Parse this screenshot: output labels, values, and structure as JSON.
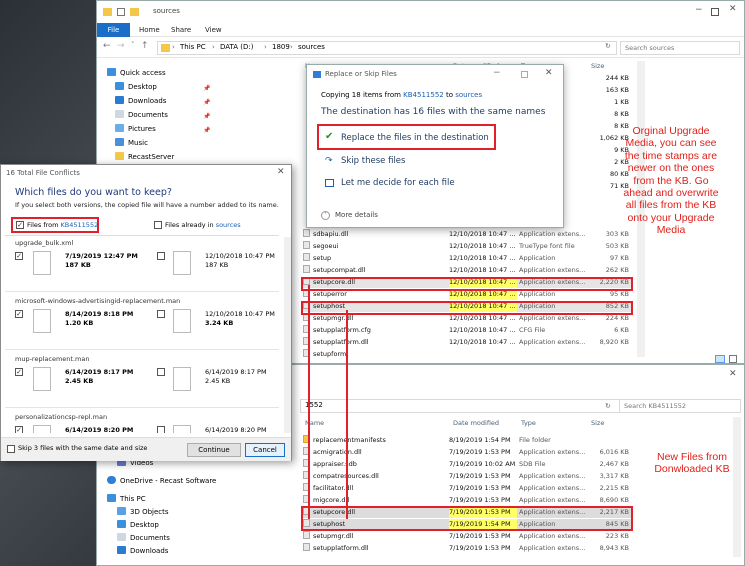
{
  "top_window": {
    "title": "sources",
    "ribbon_tabs": [
      "File",
      "Home",
      "Share",
      "View"
    ],
    "breadcrumb": [
      "This PC",
      "DATA (D:)",
      "1809",
      "sources"
    ],
    "search_placeholder": "Search sources",
    "columns": {
      "name": "Name",
      "date": "Date modified",
      "type": "Type",
      "size": "Size"
    },
    "nav": [
      "Quick access",
      "Desktop",
      "Downloads",
      "Documents",
      "Pictures",
      "Music",
      "RecastServer"
    ],
    "sizes_top": [
      "244 KB",
      "163 KB",
      "1 KB",
      "8 KB",
      "8 KB",
      "1,062 KB",
      "9 KB",
      "2 KB",
      "80 KB",
      "71 KB"
    ],
    "rows": [
      {
        "name": "sdbapiu.dll",
        "date": "12/10/2018 10:47 ...",
        "type": "Application extens...",
        "size": "303 KB"
      },
      {
        "name": "segoeui",
        "date": "12/10/2018 10:47 ...",
        "type": "TrueType font file",
        "size": "503 KB"
      },
      {
        "name": "setup",
        "date": "12/10/2018 10:47 ...",
        "type": "Application",
        "size": "97 KB"
      },
      {
        "name": "setupcompat.dll",
        "date": "12/10/2018 10:47 ...",
        "type": "Application extens...",
        "size": "262 KB"
      },
      {
        "name": "setupcore.dll",
        "date": "12/10/2018 10:47 ...",
        "type": "Application extens...",
        "size": "2,220 KB"
      },
      {
        "name": "setuperror",
        "date": "12/10/2018 10:47 ...",
        "type": "Application",
        "size": "95 KB"
      },
      {
        "name": "setuphost",
        "date": "12/10/2018 10:47 ...",
        "type": "Application",
        "size": "852 KB"
      },
      {
        "name": "setupmgr.dll",
        "date": "12/10/2018 10:47 ...",
        "type": "Application extens...",
        "size": "224 KB"
      },
      {
        "name": "setupplatform.cfg",
        "date": "12/10/2018 10:47 ...",
        "type": "CFG File",
        "size": "6 KB"
      },
      {
        "name": "setupplatform.dll",
        "date": "12/10/2018 10:47 ...",
        "type": "Application extens...",
        "size": "8,920 KB"
      },
      {
        "name": "setupform",
        "date": "",
        "type": "",
        "size": ""
      }
    ]
  },
  "bottom_window": {
    "breadcrumb": "1552",
    "search_placeholder": "Search KB4511552",
    "columns": {
      "name": "Name",
      "date": "Date modified",
      "type": "Type",
      "size": "Size"
    },
    "nav": [
      "Videos",
      "OneDrive - Recast Software",
      "This PC",
      "3D Objects",
      "Desktop",
      "Documents",
      "Downloads"
    ],
    "rows": [
      {
        "name": "replacementmanifests",
        "date": "8/19/2019 1:54 PM",
        "type": "File folder",
        "size": ""
      },
      {
        "name": "acmigration.dll",
        "date": "7/19/2019 1:53 PM",
        "type": "Application extens...",
        "size": "6,016 KB"
      },
      {
        "name": "appraiser.sdb",
        "date": "7/19/2019 10:02 AM",
        "type": "SDB File",
        "size": "2,467 KB"
      },
      {
        "name": "compatresources.dll",
        "date": "7/19/2019 1:53 PM",
        "type": "Application extens...",
        "size": "3,317 KB"
      },
      {
        "name": "facilitator.dll",
        "date": "7/19/2019 1:53 PM",
        "type": "Application extens...",
        "size": "2,215 KB"
      },
      {
        "name": "migcore.dll",
        "date": "7/19/2019 1:53 PM",
        "type": "Application extens...",
        "size": "8,690 KB"
      },
      {
        "name": "setupcore.dll",
        "date": "7/19/2019 1:53 PM",
        "type": "Application extens...",
        "size": "2,217 KB"
      },
      {
        "name": "setuphost",
        "date": "7/19/2019 1:54 PM",
        "type": "Application",
        "size": "845 KB"
      },
      {
        "name": "setupmgr.dll",
        "date": "7/19/2019 1:53 PM",
        "type": "Application extens...",
        "size": "223 KB"
      },
      {
        "name": "setupplatform.dll",
        "date": "7/19/2019 1:53 PM",
        "type": "Application extens...",
        "size": "8,943 KB"
      }
    ]
  },
  "replace_dialog": {
    "title": "Replace or Skip Files",
    "copying_prefix": "Copying 18 items from",
    "from": "KB4511552",
    "to_word": "to",
    "dest": "sources",
    "heading": "The destination has 16 files with the same names",
    "opt_replace": "Replace the files in the destination",
    "opt_skip": "Skip these files",
    "opt_decide": "Let me decide for each file",
    "more": "More details"
  },
  "conflict_dialog": {
    "title": "16 Total File Conflicts",
    "heading": "Which files do you want to keep?",
    "subtext": "If you select both versions, the copied file will have a number added to its name.",
    "left_prefix": "Files from",
    "left_src": "KB4511552",
    "right_prefix": "Files already in",
    "right_src": "sources",
    "files": [
      {
        "name": "upgrade_bulk.xml",
        "l_date": "7/19/2019 12:47 PM",
        "l_size": "187 KB",
        "r_date": "12/10/2018 10:47 PM",
        "r_size": "187 KB"
      },
      {
        "name": "microsoft-windows-advertisingid-replacement.man",
        "l_date": "8/14/2019 8:18 PM",
        "l_size": "1.20 KB",
        "r_date": "12/10/2018 10:47 PM",
        "r_size": "3.24 KB"
      },
      {
        "name": "mup-replacement.man",
        "l_date": "6/14/2019 8:17 PM",
        "l_size": "2.45 KB",
        "r_date": "6/14/2019 8:17 PM",
        "r_size": "2.45 KB"
      },
      {
        "name": "personalizationcsp-repl.man",
        "l_date": "6/14/2019 8:20 PM",
        "l_size": "",
        "r_date": "6/14/2019 8:20 PM",
        "r_size": ""
      }
    ],
    "skip_label": "Skip 3 files with the same date and size",
    "continue": "Continue",
    "cancel": "Cancel"
  },
  "annotation_top": "Orginal Upgrade Media, you can see the time stamps are newer on the ones from the KB.  Go ahead and overwrite all files from the KB onto your Upgrade Media",
  "annotation_bottom": "New Files from Donwloaded KB",
  "colors": {
    "accent": "#1a6ec7",
    "annotation": "#e0201a",
    "highlight": "#ffff66"
  }
}
